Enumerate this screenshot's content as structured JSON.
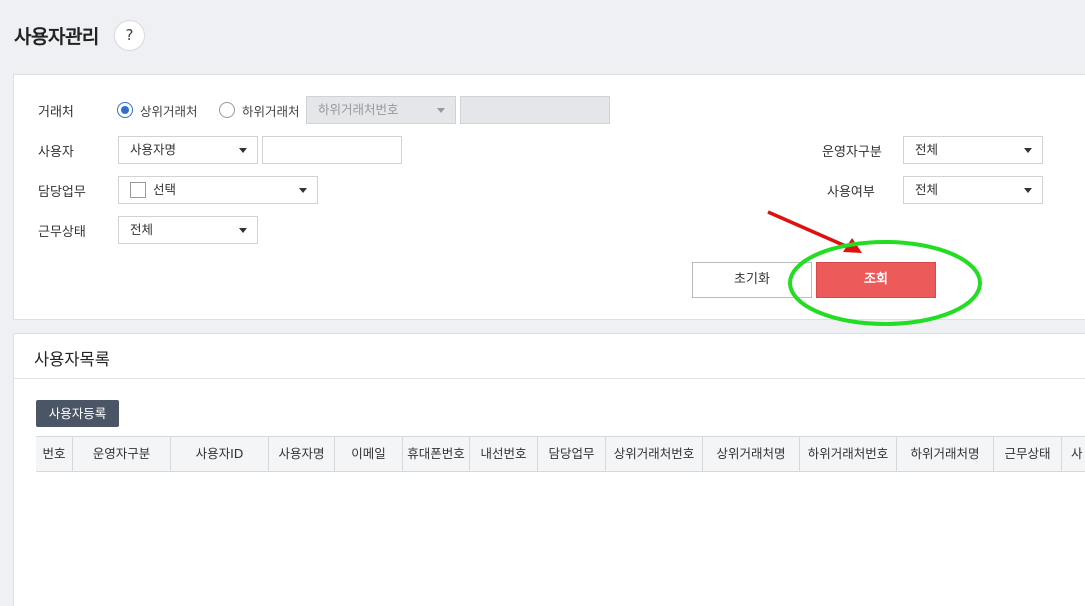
{
  "header": {
    "title": "사용자관리",
    "help_label": "?"
  },
  "search": {
    "partner_label": "거래처",
    "radio_upper_label": "상위거래처",
    "radio_lower_label": "하위거래처",
    "lower_select_placeholder": "하위거래처번호",
    "user_label": "사용자",
    "user_select_value": "사용자명",
    "user_input_value": "",
    "task_label": "담당업무",
    "task_select_value": "선택",
    "work_status_label": "근무상태",
    "work_status_value": "전체",
    "operator_type_label": "운영자구분",
    "operator_type_value": "전체",
    "use_yn_label": "사용여부",
    "use_yn_value": "전체",
    "reset_label": "초기화",
    "search_label": "조회"
  },
  "list": {
    "title": "사용자목록",
    "register_label": "사용자등록",
    "columns": [
      "번호",
      "운영자구분",
      "사용자ID",
      "사용자명",
      "이메일",
      "휴대폰번호",
      "내선번호",
      "담당업무",
      "상위거래처번호",
      "상위거래처명",
      "하위거래처번호",
      "하위거래처명",
      "근무상태",
      "사"
    ]
  },
  "colors": {
    "accent_blue": "#2f6fd0",
    "search_button": "#ec5a5a",
    "register_button": "#4a5566",
    "annotation_arrow": "#e01010",
    "annotation_ellipse": "#22dd22"
  }
}
